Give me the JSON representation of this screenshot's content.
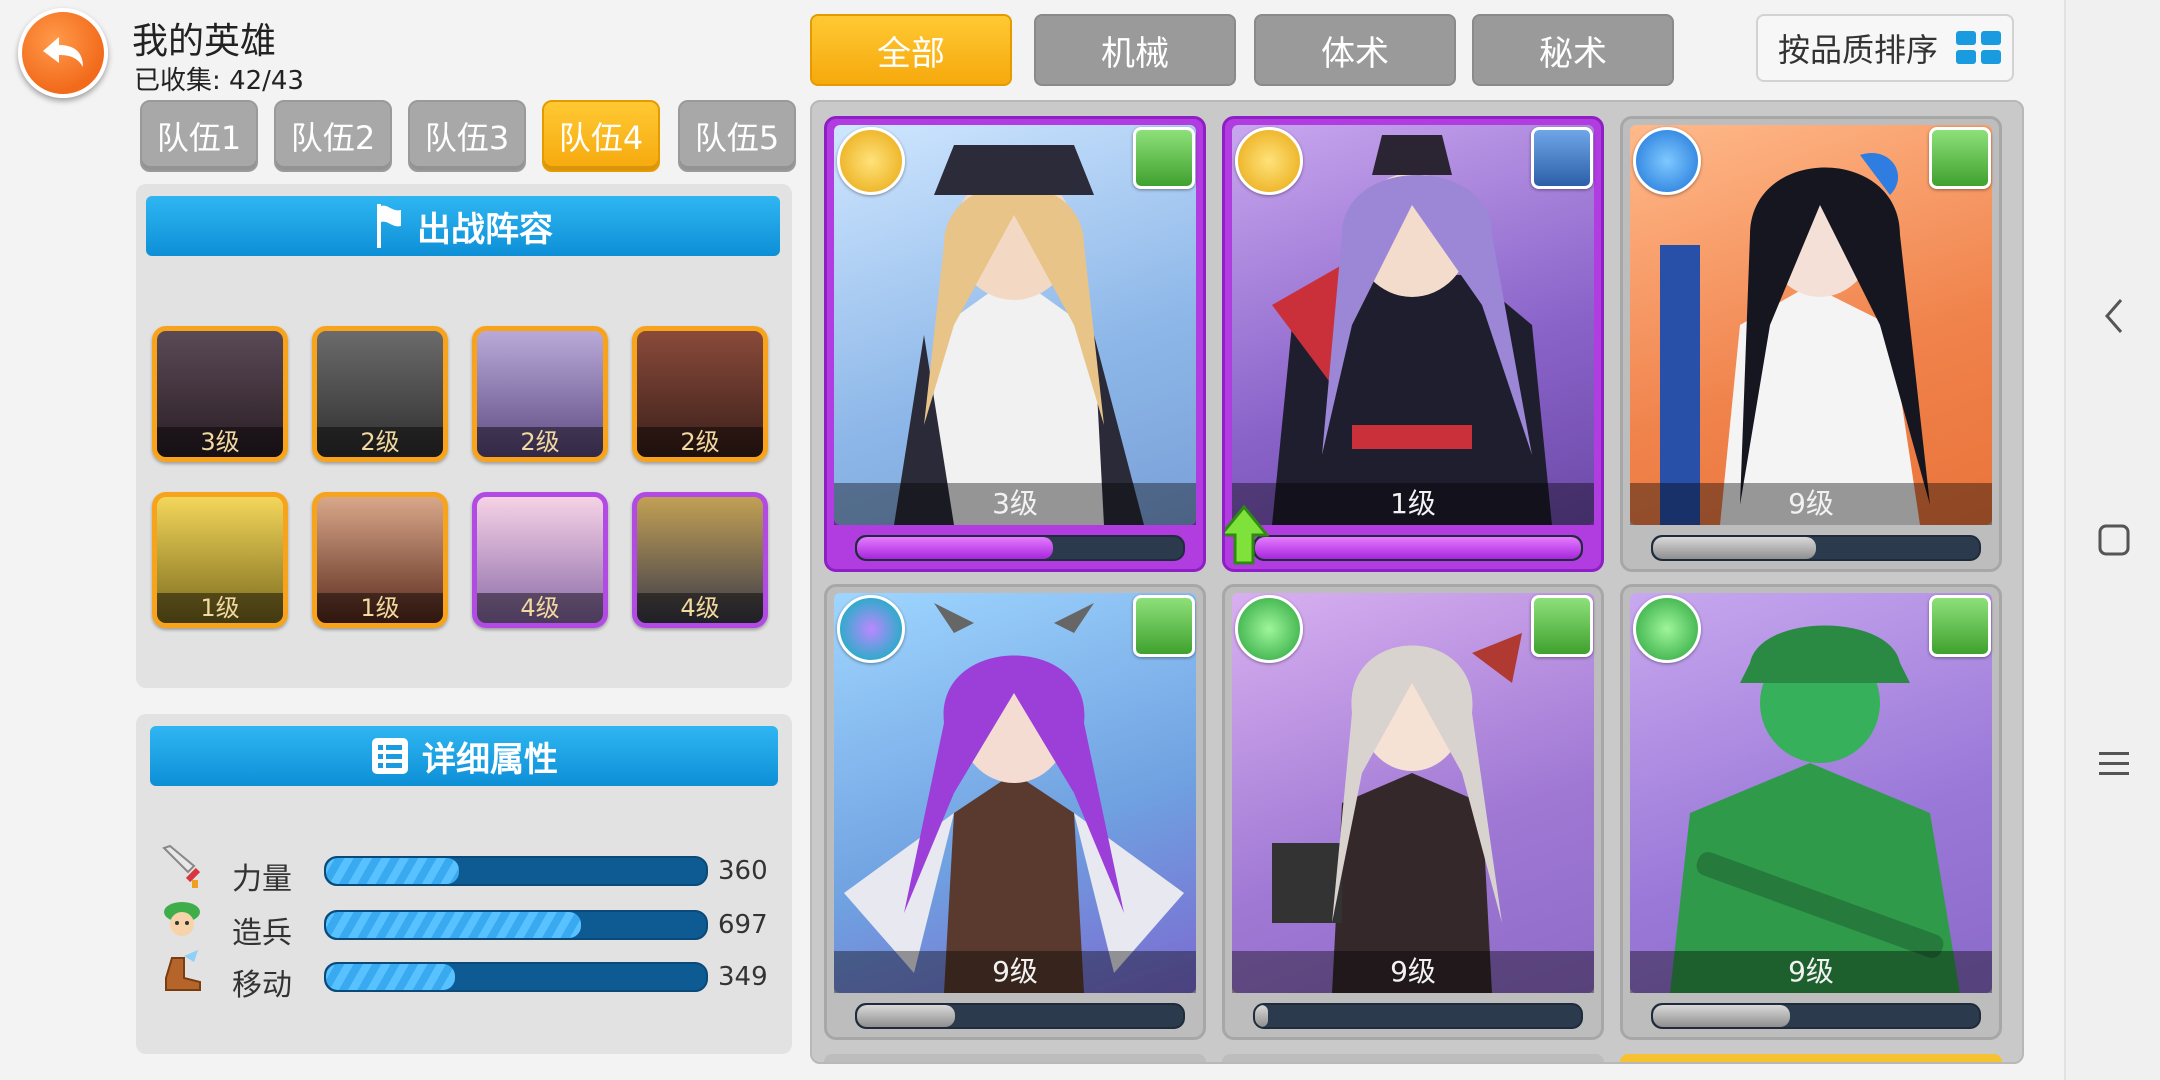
{
  "header": {
    "title": "我的英雄",
    "collected": "已收集: 42/43"
  },
  "teams": [
    "队伍1",
    "队伍2",
    "队伍3",
    "队伍4",
    "队伍5"
  ],
  "active_team": "队伍4",
  "lineup": {
    "title": "出战阵容",
    "heroes": [
      {
        "level": "3级",
        "color": "orange"
      },
      {
        "level": "2级",
        "color": "orange"
      },
      {
        "level": "2级",
        "color": "orange"
      },
      {
        "level": "2级",
        "color": "orange"
      },
      {
        "level": "1级",
        "color": "orange"
      },
      {
        "level": "1级",
        "color": "orange"
      },
      {
        "level": "4级",
        "color": "purple"
      },
      {
        "level": "4级",
        "color": "purple"
      }
    ]
  },
  "details": {
    "title": "详细属性",
    "stats": [
      {
        "label": "力量",
        "value": "360",
        "icon": "sword-icon",
        "fill": 0.35
      },
      {
        "label": "造兵",
        "value": "697",
        "icon": "soldier-icon",
        "fill": 0.67
      },
      {
        "label": "移动",
        "value": "349",
        "icon": "boot-icon",
        "fill": 0.34
      }
    ]
  },
  "filters": [
    "全部",
    "机械",
    "体术",
    "秘术"
  ],
  "active_filter": "全部",
  "sort_label": "按品质排序",
  "hero_cards": [
    {
      "level": "3级",
      "rarity": "epic",
      "progress": 0.6
    },
    {
      "level": "1级",
      "rarity": "epic",
      "progress": 1.0
    },
    {
      "level": "9级",
      "rarity": "normal",
      "progress": 0.5
    },
    {
      "level": "9级",
      "rarity": "normal",
      "progress": 0.3
    },
    {
      "level": "9级",
      "rarity": "normal",
      "progress": 0.04
    },
    {
      "level": "9级",
      "rarity": "normal",
      "progress": 0.42
    }
  ],
  "colors": {
    "accent": "#f6a90d",
    "banner": "#16a1e6",
    "epic": "#b13ce0"
  }
}
